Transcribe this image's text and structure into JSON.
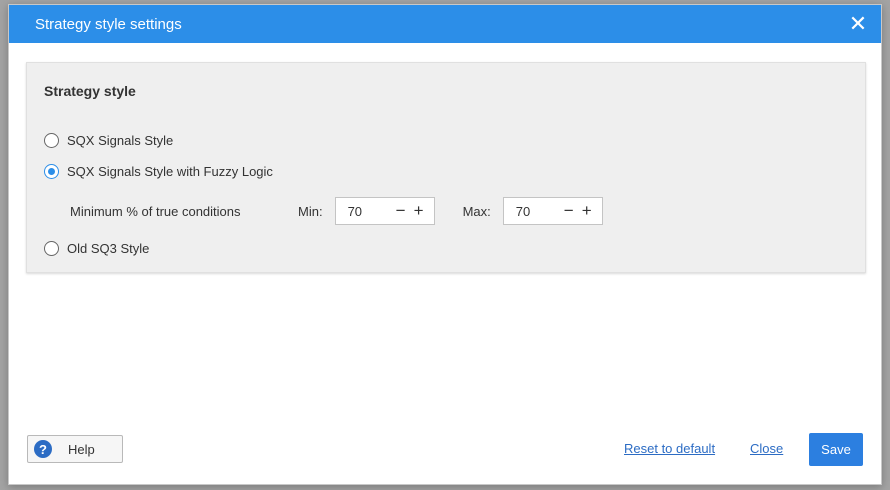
{
  "dialog": {
    "title": "Strategy style settings"
  },
  "panel": {
    "title": "Strategy style",
    "options": [
      {
        "label": "SQX Signals Style",
        "checked": false
      },
      {
        "label": "SQX Signals Style with Fuzzy Logic",
        "checked": true
      },
      {
        "label": "Old SQ3 Style",
        "checked": false
      }
    ],
    "conditions": {
      "label": "Minimum % of true conditions",
      "min_label": "Min:",
      "min_value": "70",
      "max_label": "Max:",
      "max_value": "70",
      "minus": "−",
      "plus": "+"
    }
  },
  "footer": {
    "help_label": "Help",
    "help_icon_glyph": "?",
    "reset_label": "Reset to default",
    "close_label": "Close",
    "save_label": "Save"
  },
  "colors": {
    "accent": "#2c8ee8",
    "link": "#2c6cc4"
  }
}
